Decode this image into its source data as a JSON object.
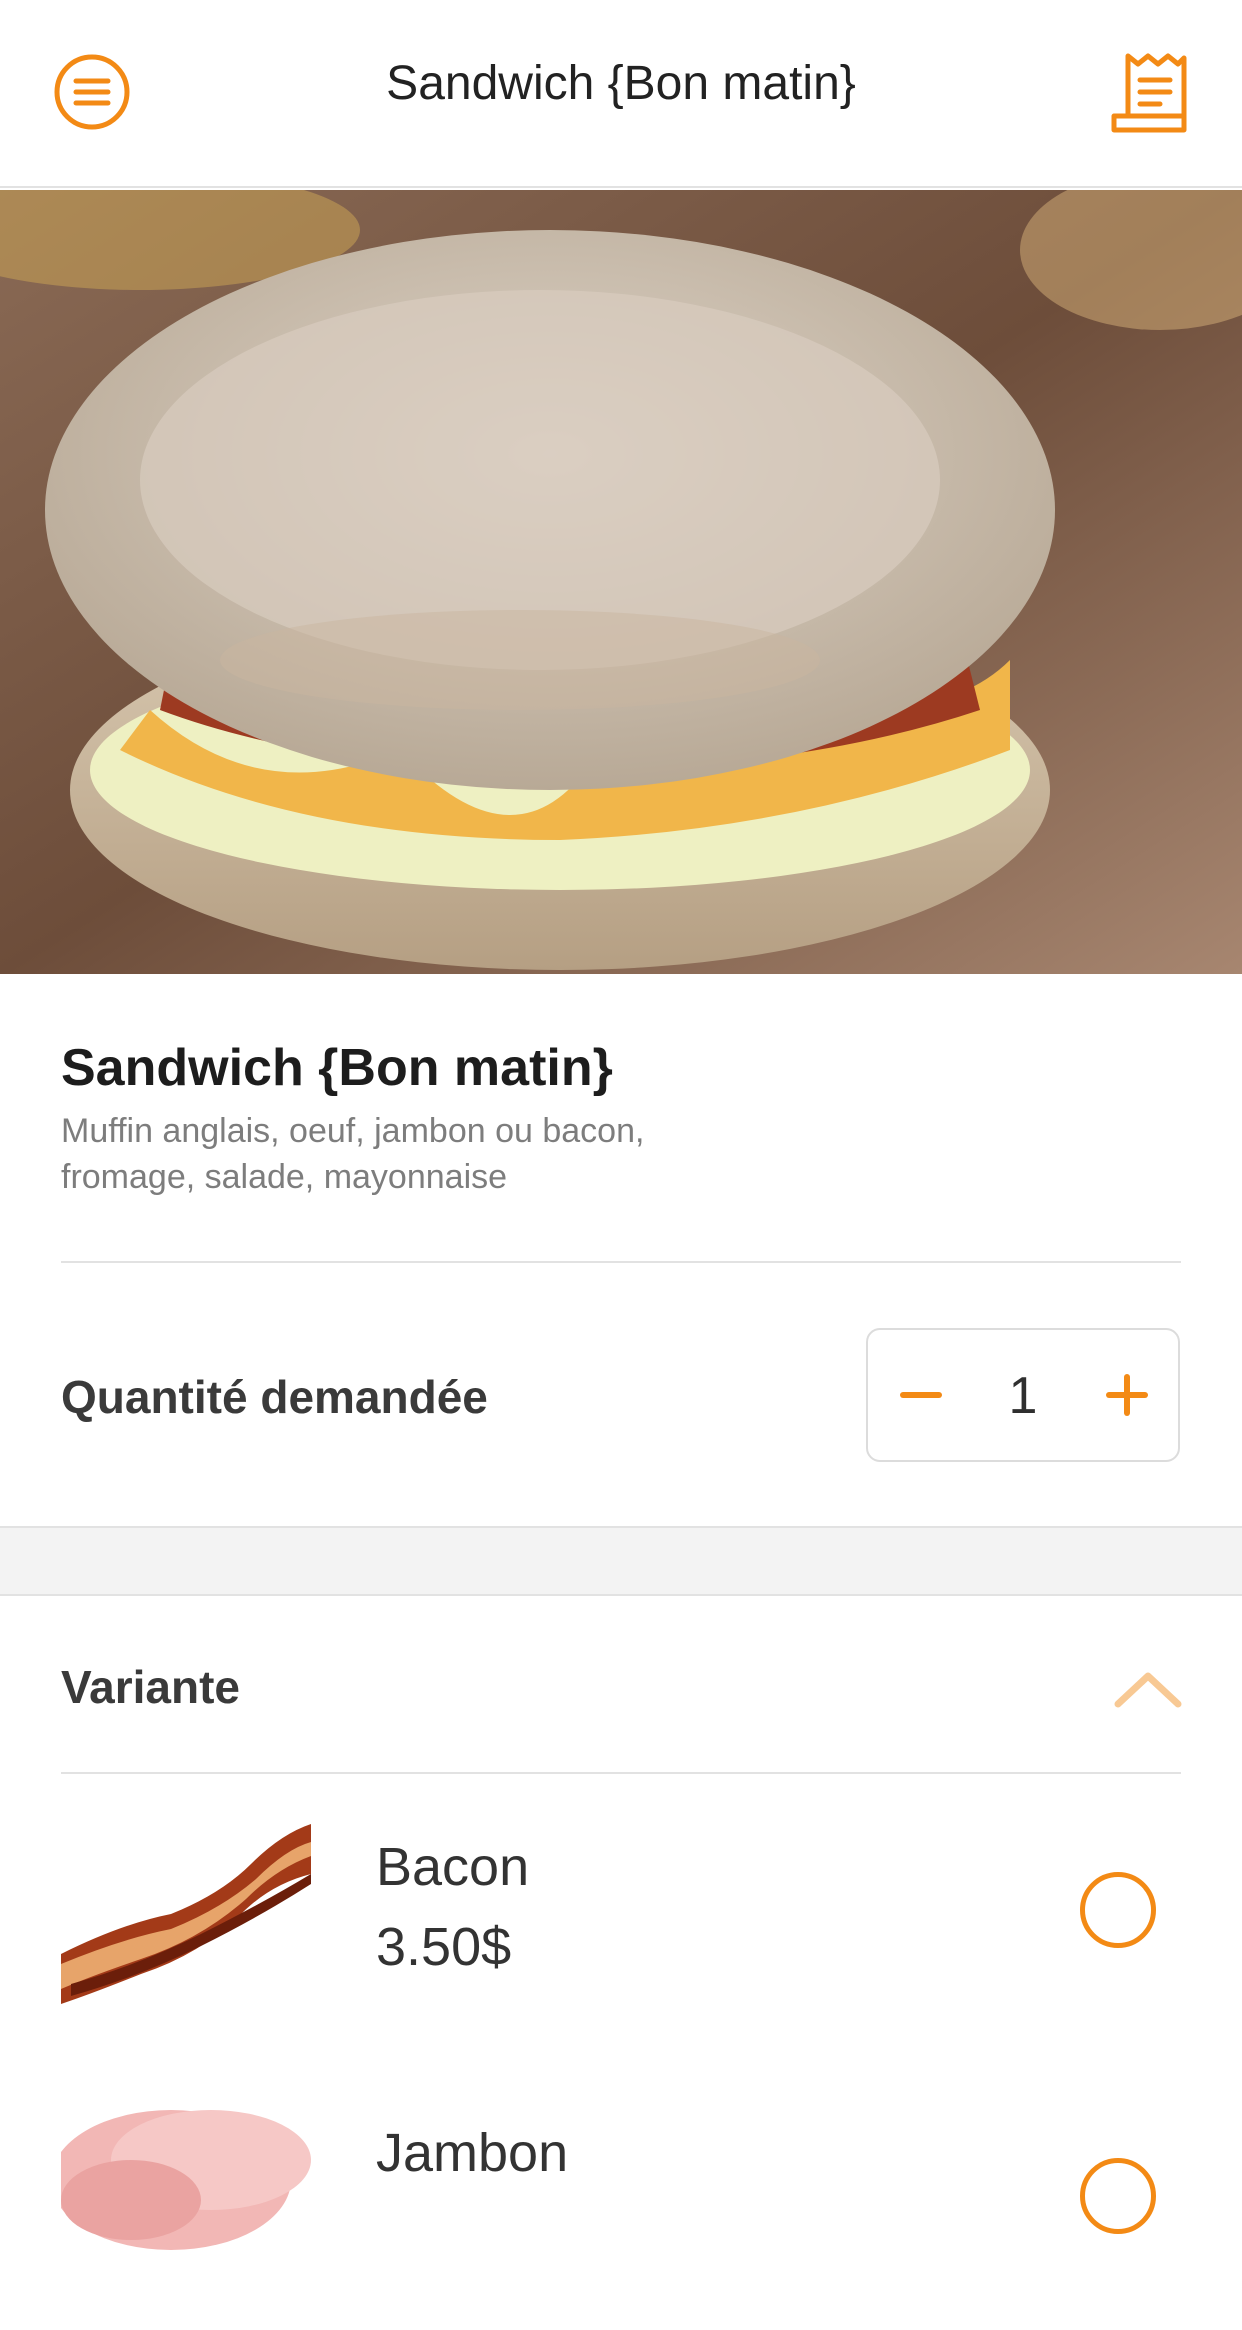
{
  "colors": {
    "accent": "#f38a15",
    "accent_light": "#f8c994",
    "text": "#2b2b2b",
    "muted": "#7d7d7d",
    "divider": "#e2e2e2",
    "band": "#f3f3f3"
  },
  "header": {
    "title": "Sandwich {Bon matin}",
    "left_icon": "menu-icon",
    "right_icon": "receipt-icon"
  },
  "product": {
    "name": "Sandwich {Bon matin}",
    "description": "Muffin anglais, oeuf, jambon ou bacon, fromage, salade, mayonnaise"
  },
  "quantity": {
    "label": "Quantité demandée",
    "value": "1"
  },
  "variants_section": {
    "title": "Variante",
    "items": [
      {
        "name": "Bacon",
        "price": "3.50$",
        "selected": false
      },
      {
        "name": "Jambon",
        "price": "",
        "selected": false
      }
    ]
  }
}
